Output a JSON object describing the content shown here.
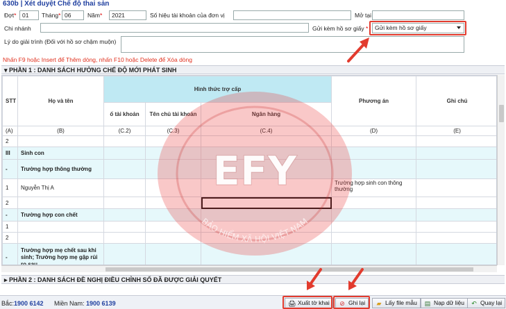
{
  "header": {
    "title": "630b | Xét duyệt Chế độ thai sản"
  },
  "form": {
    "dot_label": "Đợt",
    "dot_value": "01",
    "thang_label": "Tháng",
    "thang_value": "06",
    "nam_label": "Năm",
    "nam_value": "2021",
    "so_hieu_label": "Số hiệu tài khoản của đơn vị",
    "so_hieu_value": "",
    "mo_tai_label": "Mở tại",
    "mo_tai_value": "",
    "chi_nhanh_label": "Chi nhánh",
    "chi_nhanh_value": "",
    "gui_kem_label": "Gửi kèm hồ sơ giấy",
    "gui_kem_value": "Gửi kèm hồ sơ giấy",
    "ly_do_label": "Lý do giải trình (Đối với hồ sơ chậm muộn)",
    "ly_do_value": "",
    "required_mark": "*"
  },
  "hint": "Nhấn F9 hoặc Insert để Thêm dòng, nhấn F10 hoặc Delete để Xóa dòng",
  "section1": {
    "title": "PHẦN 1 : DANH SÁCH HƯỞNG CHẾ ĐỘ MỚI PHÁT SINH"
  },
  "section2": {
    "title": "PHẦN 2 : DANH SÁCH ĐỀ NGHỊ ĐIỀU CHỈNH SỐ ĐÃ ĐƯỢC GIẢI QUYẾT"
  },
  "table": {
    "headers": {
      "stt": "STT",
      "ho_ten": "Họ và tên",
      "hinh_thuc": "Hình thức trợ cấp",
      "so_tk": "ố tài khoản",
      "ten_chu": "Tên chủ tài khoản",
      "ngan_hang": "Ngân hàng",
      "phuong_an": "Phương án",
      "ghi_chu": "Ghi chú"
    },
    "codes": [
      "(A)",
      "(B)",
      "(C.2)",
      "(C.3)",
      "(C.4)",
      "(D)",
      "(E)"
    ],
    "rows": [
      {
        "stt": "2",
        "name": "",
        "phuong_an": ""
      },
      {
        "stt": "III",
        "name": "Sinh con",
        "phuong_an": ""
      },
      {
        "stt": "-",
        "name": "Trường hợp thông thường",
        "phuong_an": ""
      },
      {
        "stt": "1",
        "name": "Nguyễn Thị A",
        "phuong_an": "Trường hợp sinh con thông thường"
      },
      {
        "stt": "2",
        "name": "",
        "phuong_an": ""
      },
      {
        "stt": "-",
        "name": "Trường hợp con chết",
        "phuong_an": ""
      },
      {
        "stt": "1",
        "name": "",
        "phuong_an": ""
      },
      {
        "stt": "2",
        "name": "",
        "phuong_an": ""
      },
      {
        "stt": "-",
        "name": "Trường hợp mẹ chết sau khi sinh; Trường hợp mẹ gặp rủi ro sau",
        "phuong_an": ""
      }
    ]
  },
  "watermark": {
    "text": "EFY",
    "ring_text": "BẢO HIỂM XÃ HỘI VIỆT NAM"
  },
  "footer": {
    "bac_label": "Bắc:",
    "bac_phone": "1900 6142",
    "mien_nam_label": "Miền Nam:",
    "mien_nam_phone": "1900 6139",
    "buttons": {
      "xuat": "Xuất tờ khai",
      "ghi": "Ghi lại",
      "lay": "Lấy file mẫu",
      "nap": "Nạp dữ liệu",
      "quay": "Quay lại"
    }
  },
  "colors": {
    "accent_red": "#e23b2e",
    "title_blue": "#1f3f9f",
    "header_cyan": "#bfe9f3"
  }
}
